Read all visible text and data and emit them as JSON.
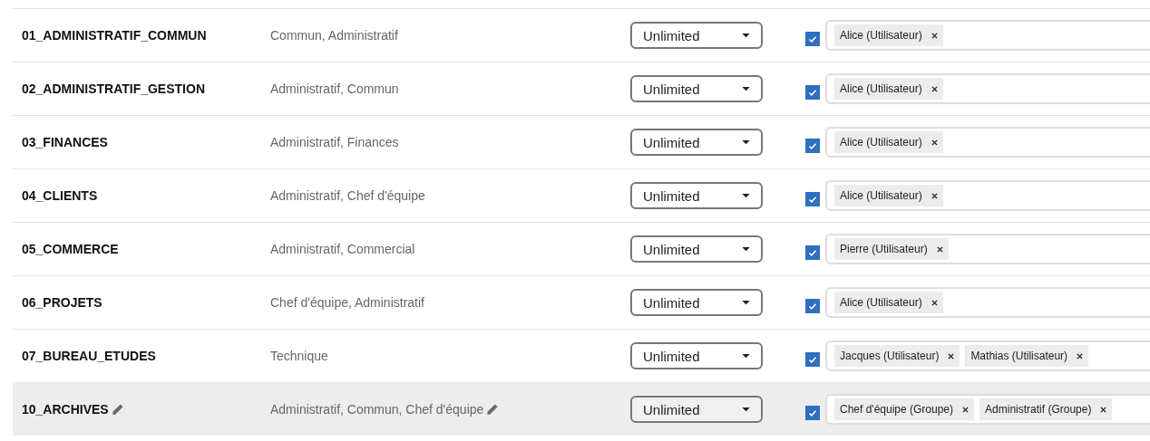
{
  "rows": [
    {
      "name": "01_ADMINISTRATIF_COMMUN",
      "groups": "Commun, Administratif",
      "quota": "Unlimited",
      "checked": true,
      "highlighted": false,
      "members": [
        "Alice (Utilisateur)"
      ]
    },
    {
      "name": "02_ADMINISTRATIF_GESTION",
      "groups": "Administratif, Commun",
      "quota": "Unlimited",
      "checked": true,
      "highlighted": false,
      "members": [
        "Alice (Utilisateur)"
      ]
    },
    {
      "name": "03_FINANCES",
      "groups": "Administratif, Finances",
      "quota": "Unlimited",
      "checked": true,
      "highlighted": false,
      "members": [
        "Alice (Utilisateur)"
      ]
    },
    {
      "name": "04_CLIENTS",
      "groups": "Administratif, Chef d'équipe",
      "quota": "Unlimited",
      "checked": true,
      "highlighted": false,
      "members": [
        "Alice (Utilisateur)"
      ]
    },
    {
      "name": "05_COMMERCE",
      "groups": "Administratif, Commercial",
      "quota": "Unlimited",
      "checked": true,
      "highlighted": false,
      "members": [
        "Pierre (Utilisateur)"
      ]
    },
    {
      "name": "06_PROJETS",
      "groups": "Chef d'équipe, Administratif",
      "quota": "Unlimited",
      "checked": true,
      "highlighted": false,
      "members": [
        "Alice (Utilisateur)"
      ]
    },
    {
      "name": "07_BUREAU_ETUDES",
      "groups": "Technique",
      "quota": "Unlimited",
      "checked": true,
      "highlighted": false,
      "members": [
        "Jacques (Utilisateur)",
        "Mathias (Utilisateur)"
      ]
    },
    {
      "name": "10_ARCHIVES",
      "groups": "Administratif, Commun, Chef d'équipe",
      "quota": "Unlimited",
      "checked": true,
      "highlighted": true,
      "members": [
        "Chef d'équipe (Groupe)",
        "Administratif (Groupe)"
      ]
    }
  ]
}
